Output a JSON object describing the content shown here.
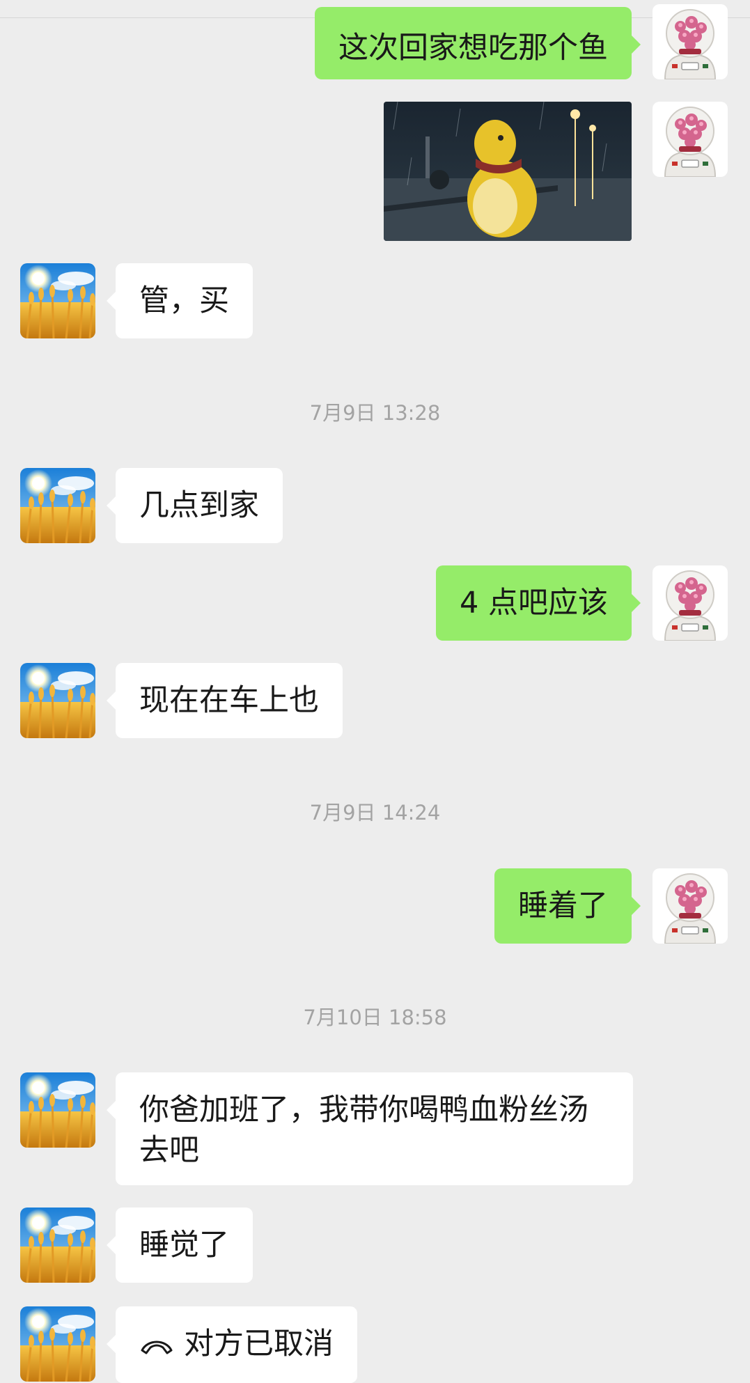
{
  "messages": [
    {
      "id": "m1",
      "text": "这次回家想吃那个鱼"
    },
    {
      "id": "m3",
      "text": "管，买"
    },
    {
      "id": "m4",
      "text": "几点到家"
    },
    {
      "id": "m5",
      "text": "4 点吧应该"
    },
    {
      "id": "m6",
      "text": "现在在车上也"
    },
    {
      "id": "m7",
      "text": "睡着了"
    },
    {
      "id": "m8",
      "text": "你爸加班了，我带你喝鸭血粉丝汤去吧"
    },
    {
      "id": "m9",
      "text": "睡觉了"
    },
    {
      "id": "m10",
      "text": "对方已取消"
    }
  ],
  "timestamps": [
    "7月9日 13:28",
    "7月9日 14:24",
    "7月10日 18:58"
  ],
  "colors": {
    "background": "#ededed",
    "incoming_bubble": "#ffffff",
    "outgoing_bubble": "#95ec69",
    "timestamp_text": "#a3a3a3"
  },
  "icons": {
    "incoming_avatar": "wheat-field-sun-avatar",
    "outgoing_avatar": "astronaut-pink-avatar",
    "call": "phone-hangup-icon"
  }
}
